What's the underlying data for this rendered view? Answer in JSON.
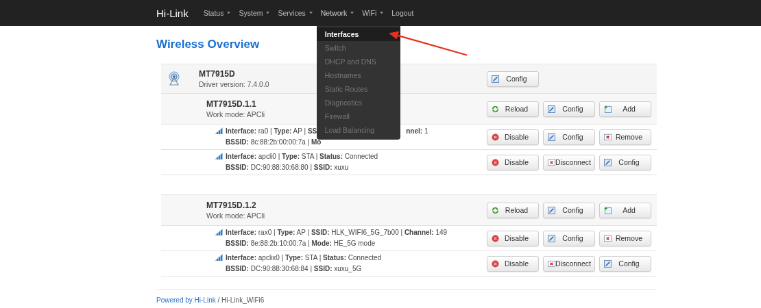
{
  "navbar": {
    "brand": "Hi-Link",
    "menus": [
      {
        "label": "Status",
        "dropdown": true,
        "expanded": false
      },
      {
        "label": "System",
        "dropdown": true,
        "expanded": false
      },
      {
        "label": "Services",
        "dropdown": true,
        "expanded": false
      },
      {
        "label": "Network",
        "dropdown": true,
        "expanded": true,
        "items": [
          {
            "label": "Interfaces",
            "selected": true
          },
          {
            "label": "Switch",
            "selected": false
          },
          {
            "label": "DHCP and DNS",
            "selected": false
          },
          {
            "label": "Hostnames",
            "selected": false
          },
          {
            "label": "Static Routes",
            "selected": false
          },
          {
            "label": "Diagnostics",
            "selected": false
          },
          {
            "label": "Firewall",
            "selected": false
          },
          {
            "label": "Load Balancing",
            "selected": false
          }
        ]
      },
      {
        "label": "WiFi",
        "dropdown": true,
        "expanded": false
      },
      {
        "label": "Logout",
        "dropdown": false,
        "expanded": false
      }
    ]
  },
  "title": "Wireless Overview",
  "devices": [
    {
      "name": "MT7915D",
      "subtitle": "Driver version: 7.4.0.0",
      "buttons": [
        {
          "label": "Config",
          "kind": "edit"
        }
      ],
      "networks": [
        {
          "name": "MT7915D.1.1",
          "subtitle": "Work mode: APCli",
          "buttons": [
            {
              "label": "Reload",
              "kind": "reload"
            },
            {
              "label": "Config",
              "kind": "edit"
            },
            {
              "label": "Add",
              "kind": "add"
            }
          ],
          "interfaces": [
            {
              "lines": [
                [
                  "**Interface:** ra0 | **Type:** AP | **SS**",
                  "**nnel:** 1"
                ],
                [
                  "**BSSID:** 8c:88:2b:00:00:7a | **Mo**"
                ]
              ],
              "buttons": [
                {
                  "label": "Disable",
                  "kind": "disable"
                },
                {
                  "label": "Config",
                  "kind": "edit"
                },
                {
                  "label": "Remove",
                  "kind": "remove"
                }
              ]
            },
            {
              "lines": [
                [
                  "**Interface:** apcli0 | **Type:** STA | **Status:** Connected"
                ],
                [
                  "**BSSID:** DC:90:88:30:68:80 | **SSID:** xuxu"
                ]
              ],
              "buttons": [
                {
                  "label": "Disable",
                  "kind": "disable"
                },
                {
                  "label": "Disconnect",
                  "kind": "remove"
                },
                {
                  "label": "Config",
                  "kind": "edit"
                }
              ]
            }
          ]
        },
        {
          "name": "MT7915D.1.2",
          "subtitle": "Work mode: APCli",
          "buttons": [
            {
              "label": "Reload",
              "kind": "reload"
            },
            {
              "label": "Config",
              "kind": "edit"
            },
            {
              "label": "Add",
              "kind": "add"
            }
          ],
          "interfaces": [
            {
              "lines": [
                [
                  "**Interface:** rax0 | **Type:** AP | **SSID:** HLK_WIFI6_5G_7b00 | **Channel:** 149"
                ],
                [
                  "**BSSID:** 8e:88:2b:10:00:7a | **Mode:** HE_5G mode"
                ]
              ],
              "buttons": [
                {
                  "label": "Disable",
                  "kind": "disable"
                },
                {
                  "label": "Config",
                  "kind": "edit"
                },
                {
                  "label": "Remove",
                  "kind": "remove"
                }
              ]
            },
            {
              "lines": [
                [
                  "**Interface:** apclix0 | **Type:** STA | **Status:** Connected"
                ],
                [
                  "**BSSID:** DC:90:88:30:68:84 | **SSID:** xuxu_5G"
                ]
              ],
              "buttons": [
                {
                  "label": "Disable",
                  "kind": "disable"
                },
                {
                  "label": "Disconnect",
                  "kind": "remove"
                },
                {
                  "label": "Config",
                  "kind": "edit"
                }
              ]
            }
          ]
        }
      ]
    }
  ],
  "footer": {
    "link": "Powered by Hi-Link",
    "rest": " / Hi-Link_WiFi6"
  }
}
